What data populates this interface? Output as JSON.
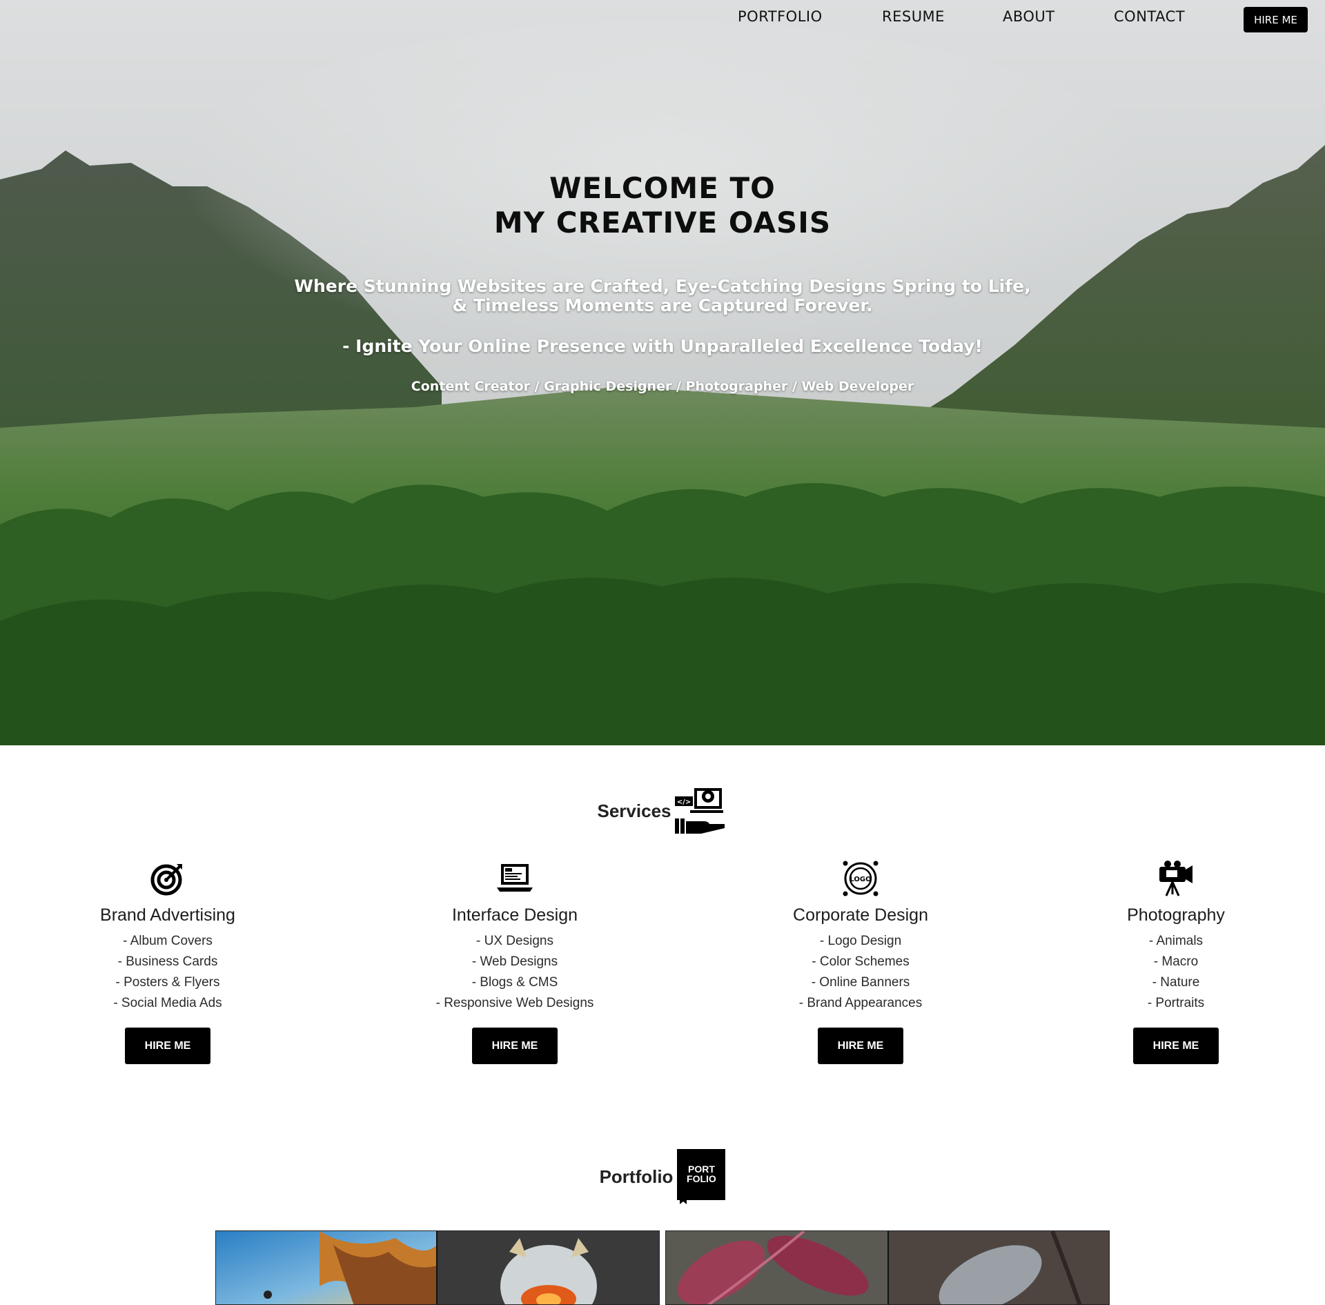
{
  "nav": {
    "links": [
      "PORTFOLIO",
      "RESUME",
      "ABOUT",
      "CONTACT"
    ],
    "hire_label": "HIRE ME"
  },
  "hero": {
    "title_line1": "WELCOME TO",
    "title_line2": "MY CREATIVE OASIS",
    "tagline_line1": "Where Stunning Websites are Crafted, Eye-Catching Designs Spring to Life,",
    "tagline_line2": "& Timeless Moments are Captured Forever.",
    "cta": "- Ignite Your Online Presence with Unparalleled Excellence Today!",
    "roles": "Content Creator / Graphic Designer / Photographer / Web Developer"
  },
  "services": {
    "heading": "Services",
    "items": [
      {
        "title": "Brand Advertising",
        "icon": "target-icon",
        "list": [
          "- Album Covers",
          "- Business Cards",
          "- Posters & Flyers",
          "- Social Media Ads"
        ],
        "button": "HIRE ME"
      },
      {
        "title": "Interface Design",
        "icon": "laptop-code-icon",
        "list": [
          "- UX Designs",
          "- Web Designs",
          "- Blogs & CMS",
          "- Responsive Web Designs"
        ],
        "button": "HIRE ME"
      },
      {
        "title": "Corporate Design",
        "icon": "logo-badge-icon",
        "list": [
          "- Logo Design",
          "- Color Schemes",
          "- Online Banners",
          "- Brand Appearances"
        ],
        "button": "HIRE ME"
      },
      {
        "title": "Photography",
        "icon": "video-camera-tripod-icon",
        "list": [
          "- Animals",
          "- Macro",
          "- Nature",
          "- Portraits"
        ],
        "button": "HIRE ME"
      }
    ]
  },
  "portfolio": {
    "heading": "Portfolio",
    "badge_line1": "PORT",
    "badge_line2": "FOLIO"
  },
  "colors": {
    "button_bg": "#000000",
    "button_text": "#ffffff",
    "page_bg": "#ffffff"
  }
}
